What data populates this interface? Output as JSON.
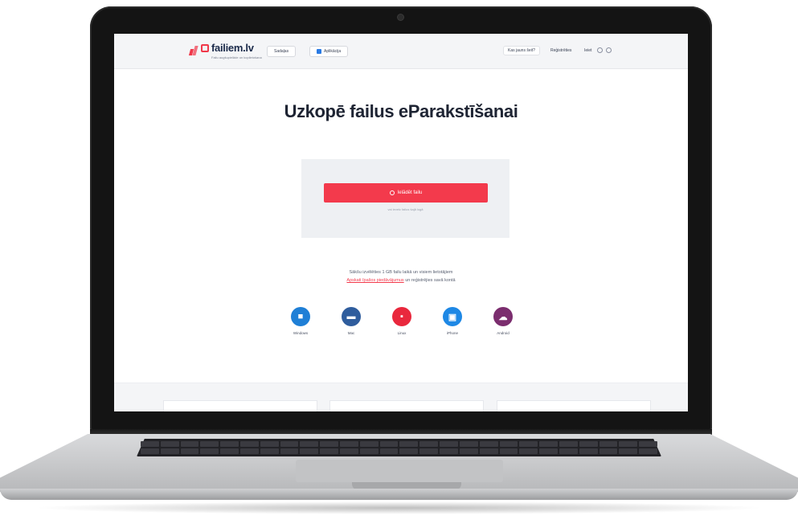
{
  "header": {
    "logo_text": "failiem.lv",
    "logo_tagline": "Failu augšupielāde un koplietošana",
    "nav_buttons": [
      "Sadaļas",
      "Aplikācija"
    ],
    "links": [
      "Kas jauns šeit?",
      "Reģistrēties",
      "Ieiet"
    ]
  },
  "main": {
    "title": "Uzkopē failus eParakstīšanai",
    "upload_button": "Ielādēt failu",
    "upload_hint": "vai ievelc failus šajā logā",
    "info_prefix": "Sākšu izvēlēties 1 GB failu laikā un visiem lietotājiem",
    "info_link": "Apskati īpašos piedāvājumus",
    "info_suffix": "un reģistrējies savā kontā"
  },
  "apps": [
    {
      "label": "Windows",
      "icon": "device-icon"
    },
    {
      "label": "Mac",
      "icon": "monitor-icon"
    },
    {
      "label": "Linux",
      "icon": "folder-icon"
    },
    {
      "label": "iPhone",
      "icon": "phone-icon"
    },
    {
      "label": "Android",
      "icon": "cloud-icon"
    }
  ],
  "colors": {
    "accent": "#f33a4c",
    "title": "#1e2433",
    "panel": "#eef0f3"
  }
}
